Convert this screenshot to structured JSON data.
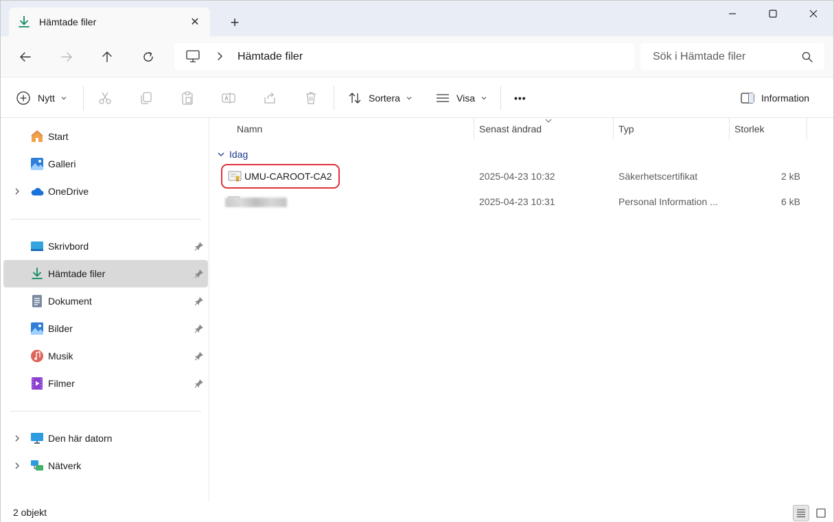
{
  "tab": {
    "title": "Hämtade filer",
    "close": "✕",
    "new_tab": "+"
  },
  "address": {
    "crumb": "Hämtade filer"
  },
  "search": {
    "placeholder": "Sök i Hämtade filer"
  },
  "toolbar": {
    "new_label": "Nytt",
    "sort_label": "Sortera",
    "view_label": "Visa",
    "more_label": "•••",
    "info_label": "Information"
  },
  "sidebar": {
    "quick": [
      {
        "label": "Start",
        "icon": "home-icon"
      },
      {
        "label": "Galleri",
        "icon": "gallery-icon"
      },
      {
        "label": "OneDrive",
        "icon": "cloud-icon"
      }
    ],
    "pinned": [
      {
        "label": "Skrivbord",
        "icon": "desktop-icon"
      },
      {
        "label": "Hämtade filer",
        "icon": "download-icon"
      },
      {
        "label": "Dokument",
        "icon": "document-icon"
      },
      {
        "label": "Bilder",
        "icon": "pictures-icon"
      },
      {
        "label": "Musik",
        "icon": "music-icon"
      },
      {
        "label": "Filmer",
        "icon": "video-icon"
      }
    ],
    "devices": [
      {
        "label": "Den här datorn",
        "icon": "computer-icon"
      },
      {
        "label": "Nätverk",
        "icon": "network-icon"
      }
    ]
  },
  "columns": {
    "name": "Namn",
    "modified": "Senast ändrad",
    "type": "Typ",
    "size": "Storlek"
  },
  "group": {
    "label": "Idag"
  },
  "files": [
    {
      "name": "UMU-CAROOT-CA2",
      "modified": "2025-04-23 10:32",
      "type": "Säkerhetscertifikat",
      "size": "2 kB",
      "icon": "certificate-icon"
    },
    {
      "name": "",
      "modified": "2025-04-23 10:31",
      "type": "Personal Information ...",
      "size": "6 kB",
      "icon": "pfx-certificate-icon"
    }
  ],
  "status": {
    "count": "2 objekt"
  },
  "colors": {
    "accent": "#0f8a5f",
    "highlight": "#e0303a",
    "group": "#1b3a8a"
  }
}
